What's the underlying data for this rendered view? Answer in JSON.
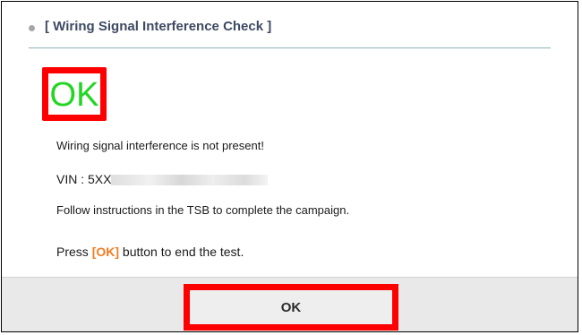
{
  "header": {
    "title": "[ Wiring Signal Interference Check ]"
  },
  "result": {
    "status": "OK",
    "status_color": "#22d622",
    "highlight_color": "#ff0000"
  },
  "messages": {
    "line1": "Wiring signal interference is not present!",
    "vin_label": "VIN : 5XX",
    "line3": "Follow instructions in the TSB to complete the campaign.",
    "press_prefix": "Press ",
    "press_button": "[OK]",
    "press_suffix": " button to end the test."
  },
  "footer": {
    "ok_label": "OK"
  }
}
